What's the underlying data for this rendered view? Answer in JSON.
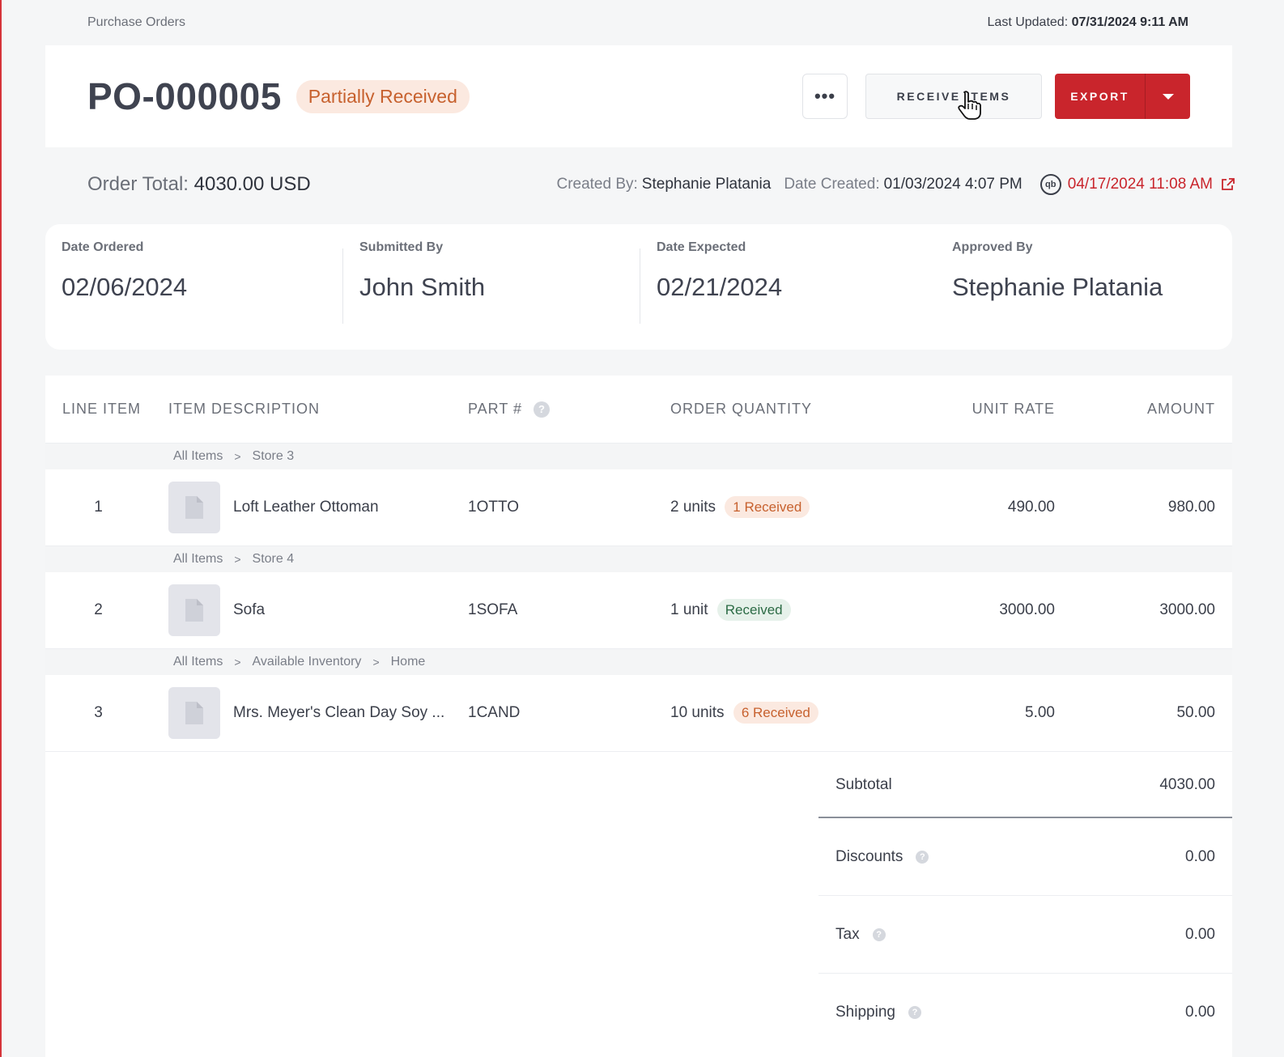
{
  "breadcrumb": "Purchase Orders",
  "last_updated_label": "Last Updated:",
  "last_updated_value": "07/31/2024 9:11 AM",
  "po": {
    "number": "PO-000005",
    "status": "Partially Received",
    "more_label": "•••",
    "receive_label": "RECEIVE ITEMS",
    "export_label": "EXPORT"
  },
  "summary": {
    "order_total_label": "Order Total:",
    "order_total_value": "4030.00 USD",
    "created_by_label": "Created By:",
    "created_by_value": "Stephanie Platania",
    "date_created_label": "Date Created:",
    "date_created_value": "01/03/2024 4:07 PM",
    "qb_glyph": "qb",
    "sync_date": "04/17/2024 11:08 AM"
  },
  "info": [
    {
      "label": "Date Ordered",
      "value": "02/06/2024"
    },
    {
      "label": "Submitted By",
      "value": "John Smith"
    },
    {
      "label": "Date Expected",
      "value": "02/21/2024"
    },
    {
      "label": "Approved By",
      "value": "Stephanie Platania"
    }
  ],
  "table": {
    "headers": {
      "line": "LINE ITEM",
      "desc": "ITEM DESCRIPTION",
      "part": "PART #",
      "qty": "ORDER QUANTITY",
      "rate": "UNIT RATE",
      "amount": "AMOUNT"
    },
    "help_glyph": "?",
    "crumb_sep": ">",
    "groups": [
      {
        "crumbs": [
          "All Items",
          "Store 3"
        ],
        "item": {
          "line": "1",
          "desc": "Loft Leather Ottoman",
          "part": "1OTTO",
          "qty": "2 units",
          "badge": "1 Received",
          "rate": "490.00",
          "amount": "980.00"
        }
      },
      {
        "crumbs": [
          "All Items",
          "Store 4"
        ],
        "item": {
          "line": "2",
          "desc": "Sofa",
          "part": "1SOFA",
          "qty": "1 unit",
          "badge": "Received",
          "rate": "3000.00",
          "amount": "3000.00"
        }
      },
      {
        "crumbs": [
          "All Items",
          "Available Inventory",
          "Home"
        ],
        "item": {
          "line": "3",
          "desc": "Mrs. Meyer's Clean Day Soy ...",
          "part": "1CAND",
          "qty": "10 units",
          "badge": "6 Received",
          "rate": "5.00",
          "amount": "50.00"
        }
      }
    ]
  },
  "totals": {
    "subtotal_label": "Subtotal",
    "subtotal": "4030.00",
    "discounts_label": "Discounts",
    "discounts": "0.00",
    "tax_label": "Tax",
    "tax": "0.00",
    "shipping_label": "Shipping",
    "shipping": "0.00"
  },
  "colors": {
    "accent": "#c9252c",
    "status_partial_bg": "#fbe9e0",
    "status_partial_text": "#c7612e",
    "status_received_bg": "#e6f1ea",
    "status_received_text": "#2c6b45"
  },
  "icons": [
    "more-icon",
    "pointer-cursor-icon",
    "chevron-down-icon",
    "quickbooks-icon",
    "external-link-icon",
    "file-icon",
    "help-icon"
  ]
}
